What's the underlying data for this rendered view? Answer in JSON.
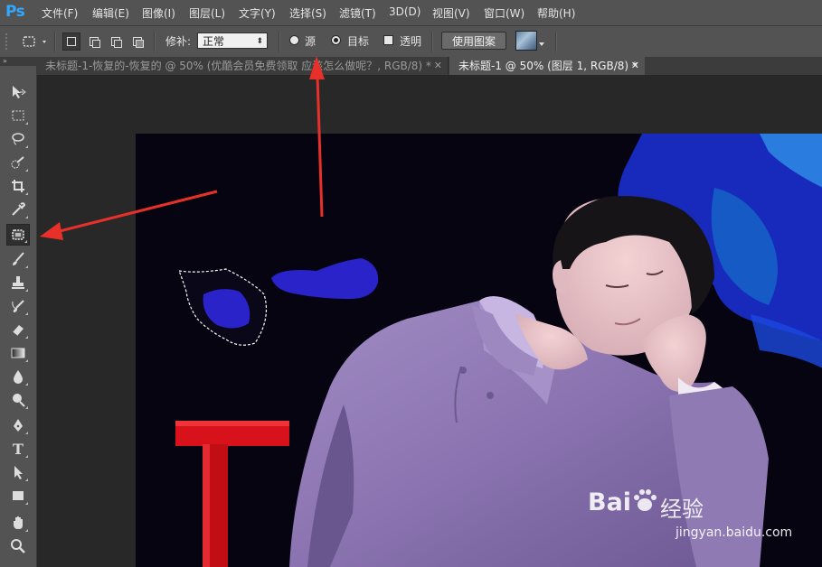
{
  "app": {
    "logo": "Ps"
  },
  "menu": [
    "文件(F)",
    "编辑(E)",
    "图像(I)",
    "图层(L)",
    "文字(Y)",
    "选择(S)",
    "滤镜(T)",
    "3D(D)",
    "视图(V)",
    "窗口(W)",
    "帮助(H)"
  ],
  "options": {
    "patch_label": "修补:",
    "patch_mode": "正常",
    "source_label": "源",
    "destination_label": "目标",
    "transparent_label": "透明",
    "use_pattern_label": "使用图案",
    "selected_radio": "目标"
  },
  "tabs": [
    {
      "title": "未标题-1-恢复的-恢复的 @ 50% (优酷会员免费领取 应该怎么做呢？, RGB/8) *",
      "active": false
    },
    {
      "title": "未标题-1 @ 50% (图层 1, RGB/8) *",
      "active": true
    }
  ],
  "tools": [
    {
      "name": "move-tool",
      "icon": "move-icon"
    },
    {
      "name": "marquee-tool",
      "icon": "rect-marquee-icon"
    },
    {
      "name": "lasso-tool",
      "icon": "lasso-icon"
    },
    {
      "name": "quick-select-tool",
      "icon": "quick-select-icon"
    },
    {
      "name": "crop-tool",
      "icon": "crop-icon"
    },
    {
      "name": "eyedropper-tool",
      "icon": "eyedropper-icon"
    },
    {
      "name": "patch-tool",
      "icon": "patch-icon",
      "active": true
    },
    {
      "name": "brush-tool",
      "icon": "brush-icon"
    },
    {
      "name": "stamp-tool",
      "icon": "stamp-icon"
    },
    {
      "name": "history-brush-tool",
      "icon": "history-brush-icon"
    },
    {
      "name": "eraser-tool",
      "icon": "eraser-icon"
    },
    {
      "name": "gradient-tool",
      "icon": "gradient-icon"
    },
    {
      "name": "blur-tool",
      "icon": "blur-icon"
    },
    {
      "name": "dodge-tool",
      "icon": "dodge-icon"
    },
    {
      "name": "pen-tool",
      "icon": "pen-icon"
    },
    {
      "name": "type-tool",
      "icon": "type-icon"
    },
    {
      "name": "path-select-tool",
      "icon": "path-select-icon"
    },
    {
      "name": "shape-tool",
      "icon": "rectangle-icon"
    },
    {
      "name": "hand-tool",
      "icon": "hand-icon"
    },
    {
      "name": "zoom-tool",
      "icon": "zoom-icon"
    }
  ],
  "watermark": {
    "brand": "Bai",
    "brand2": "经验",
    "url": "jingyan.baidu.com"
  },
  "colors": {
    "ps_blue": "#31a8ff",
    "arrow_red": "#e8302a",
    "panel": "#535353",
    "chair_red": "#d8121a",
    "robe_purple": "#8e78b2"
  }
}
